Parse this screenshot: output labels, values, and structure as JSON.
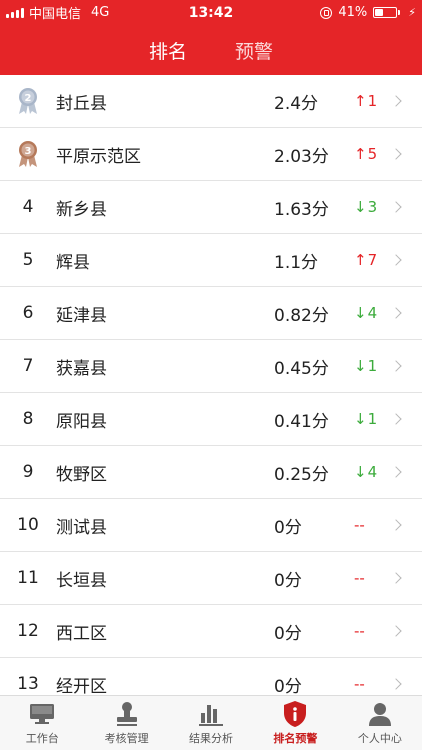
{
  "status_bar": {
    "carrier": "中国电信",
    "network": "4G",
    "time": "13:42",
    "battery": "41%",
    "battery_level": 0.41
  },
  "tabs": [
    {
      "label": "排名",
      "active": true
    },
    {
      "label": "预警",
      "active": false
    }
  ],
  "rows": [
    {
      "rank": "2",
      "medal": "silver",
      "name": "封丘县",
      "score": "2.4分",
      "trend": "up",
      "arrow": "↑",
      "change": "1"
    },
    {
      "rank": "3",
      "medal": "bronze",
      "name": "平原示范区",
      "score": "2.03分",
      "trend": "up",
      "arrow": "↑",
      "change": "5"
    },
    {
      "rank": "4",
      "medal": "",
      "name": "新乡县",
      "score": "1.63分",
      "trend": "down",
      "arrow": "↓",
      "change": "3"
    },
    {
      "rank": "5",
      "medal": "",
      "name": "辉县",
      "score": "1.1分",
      "trend": "up",
      "arrow": "↑",
      "change": "7"
    },
    {
      "rank": "6",
      "medal": "",
      "name": "延津县",
      "score": "0.82分",
      "trend": "down",
      "arrow": "↓",
      "change": "4"
    },
    {
      "rank": "7",
      "medal": "",
      "name": "获嘉县",
      "score": "0.45分",
      "trend": "down",
      "arrow": "↓",
      "change": "1"
    },
    {
      "rank": "8",
      "medal": "",
      "name": "原阳县",
      "score": "0.41分",
      "trend": "down",
      "arrow": "↓",
      "change": "1"
    },
    {
      "rank": "9",
      "medal": "",
      "name": "牧野区",
      "score": "0.25分",
      "trend": "down",
      "arrow": "↓",
      "change": "4"
    },
    {
      "rank": "10",
      "medal": "",
      "name": "测试县",
      "score": "0分",
      "trend": "none",
      "arrow": "",
      "change": "--"
    },
    {
      "rank": "11",
      "medal": "",
      "name": "长垣县",
      "score": "0分",
      "trend": "none",
      "arrow": "",
      "change": "--"
    },
    {
      "rank": "12",
      "medal": "",
      "name": "西工区",
      "score": "0分",
      "trend": "none",
      "arrow": "",
      "change": "--"
    },
    {
      "rank": "13",
      "medal": "",
      "name": "经开区",
      "score": "0分",
      "trend": "none",
      "arrow": "",
      "change": "--"
    }
  ],
  "bottom_nav": [
    {
      "label": "工作台",
      "icon": "monitor-icon",
      "active": false
    },
    {
      "label": "考核管理",
      "icon": "stamp-icon",
      "active": false
    },
    {
      "label": "结果分析",
      "icon": "bar-chart-icon",
      "active": false
    },
    {
      "label": "排名预警",
      "icon": "shield-alert-icon",
      "active": true
    },
    {
      "label": "个人中心",
      "icon": "user-icon",
      "active": false
    }
  ],
  "colors": {
    "primary_red": "#e52528",
    "up": "#e52528",
    "down": "#3cab3c",
    "silver": "#a9b6c9",
    "bronze": "#b5795a",
    "nav_icon": "#666666",
    "nav_active": "#c81e1e"
  }
}
